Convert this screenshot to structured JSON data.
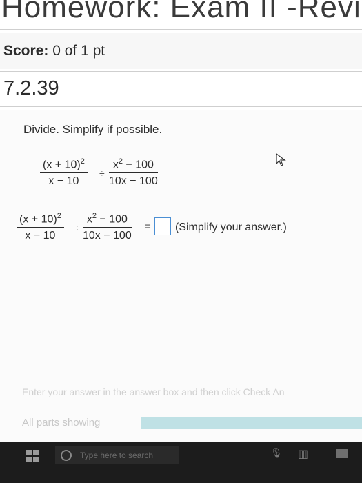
{
  "header": {
    "title": "Homework: Exam II -Revi"
  },
  "score": {
    "label": "Score:",
    "value": "0 of 1 pt"
  },
  "question": {
    "number": "7.2.39",
    "instructions": "Divide. Simplify if possible.",
    "expression": {
      "numerator1": "(x + 10)",
      "exp1": "2",
      "denominator1": "x − 10",
      "operator": "÷",
      "numerator2_base": "x",
      "numerator2_exp": "2",
      "numerator2_rest": " − 100",
      "denominator2": "10x − 100"
    },
    "equals": "=",
    "answer_value": "",
    "answer_hint": "(Simplify your answer.)"
  },
  "footer": {
    "instruction": "Enter your answer in the answer box and then click Check An",
    "parts_label": "All parts showing",
    "progress_fraction": 1.0
  },
  "taskbar": {
    "search_placeholder": "Type here to search",
    "icons": [
      "windows-start-icon",
      "cortana-circle-icon",
      "microphone-icon",
      "task-view-icon",
      "app-icon"
    ]
  }
}
